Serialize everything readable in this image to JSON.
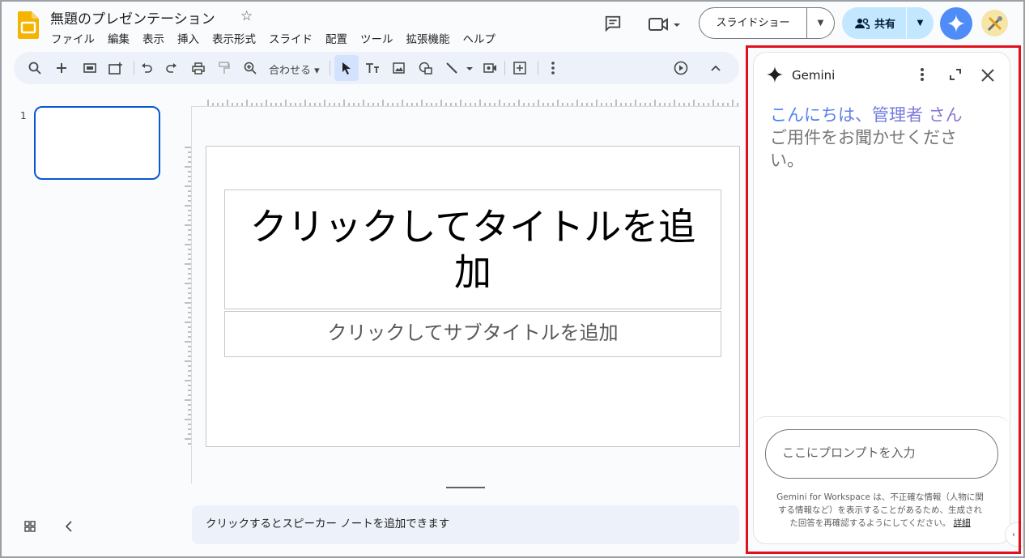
{
  "header": {
    "doc_title": "無題のプレゼンテーション",
    "menu": [
      "ファイル",
      "編集",
      "表示",
      "挿入",
      "表示形式",
      "スライド",
      "配置",
      "ツール",
      "拡張機能",
      "ヘルプ"
    ],
    "slideshow_label": "スライドショー",
    "share_label": "共有"
  },
  "toolbar": {
    "zoom_label": "合わせる",
    "icons": [
      "search-icon",
      "add-icon",
      "new-slide-icon",
      "new-slide-layout-icon",
      "undo-icon",
      "redo-icon",
      "print-icon",
      "paint-format-icon",
      "zoom-icon",
      "select-icon",
      "text-box-icon",
      "image-icon",
      "shape-icon",
      "line-icon",
      "video-icon",
      "comment-add-icon",
      "more-icon",
      "play-icon",
      "collapse-icon"
    ]
  },
  "filmstrip": {
    "slide_number": "1"
  },
  "slide": {
    "title_placeholder": "クリックしてタイトルを追加",
    "subtitle_placeholder": "クリックしてサブタイトルを追加"
  },
  "notes": {
    "placeholder": "クリックするとスピーカー ノートを追加できます"
  },
  "gemini": {
    "title": "Gemini",
    "greeting": "こんにちは、管理者 さん",
    "ask": "ご用件をお聞かせください。",
    "prompt_placeholder": "ここにプロンプトを入力",
    "disclaimer": "Gemini for Workspace は、不正確な情報（人物に関する情報など）を表示することがあるため、生成された回答を再確認するようにしてください。",
    "details_link": "詳細"
  },
  "colors": {
    "accent": "#0b57d0",
    "share_bg": "#c2e7ff",
    "toolbar_bg": "#edf2fa",
    "highlight_border": "#e0101d"
  }
}
